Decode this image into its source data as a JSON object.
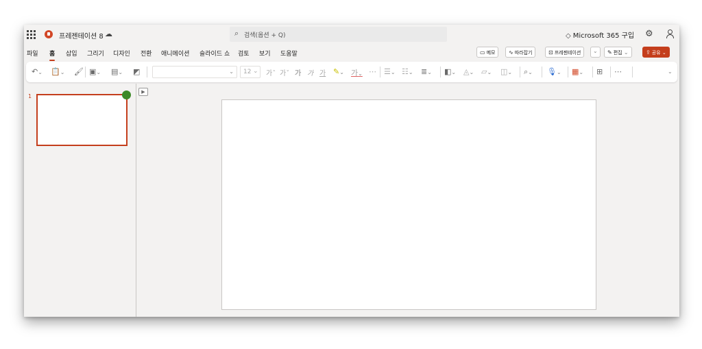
{
  "titlebar": {
    "doc_title": "프레젠테이션 8",
    "search_placeholder": "검색(옵션 + Q)",
    "m365_label": "Microsoft 365 구입"
  },
  "menu": {
    "tabs": [
      "파일",
      "홈",
      "삽입",
      "그리기",
      "디자인",
      "전환",
      "애니메이션",
      "슬라이드 쇼",
      "검토",
      "보기",
      "도움말"
    ],
    "active_tab": "홈",
    "memo_label": "메모",
    "follow_label": "따라잡기",
    "present_label": "프레젠테이션",
    "edit_label": "편집",
    "share_label": "공유"
  },
  "ribbon": {
    "font_size": "12",
    "font_buttons": [
      "가",
      "가",
      "가",
      "가",
      "가"
    ]
  },
  "slides": {
    "thumbnail_number": "1"
  },
  "colors": {
    "accent": "#c43e1c",
    "presence_dot": "#3c8a28",
    "app_icon": "#d24726"
  }
}
